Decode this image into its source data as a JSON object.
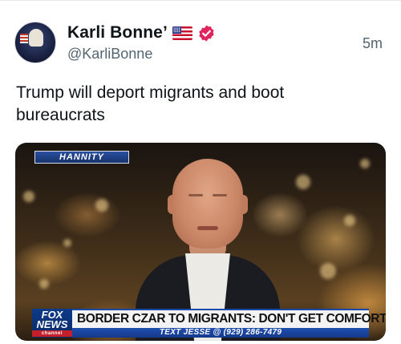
{
  "post": {
    "author": {
      "display_name": "Karli Bonne’",
      "handle": "@KarliBonne",
      "badges": [
        "us-flag-icon",
        "verified-badge-icon"
      ],
      "verified_color": "#e0245e"
    },
    "timestamp": "5m",
    "text": "Trump will deport migrants and boot bureaucrats",
    "media": {
      "show_logo": "HANNITY",
      "network": {
        "logo_line1": "FOX",
        "logo_line2": "NEWS",
        "logo_line3": "channel"
      },
      "headline": "BORDER CZAR TO MIGRANTS: DON'T GET COMFORTABLE",
      "ticker": "TEXT JESSE @ (929) 286-7479"
    }
  },
  "colors": {
    "text_primary": "#0f1419",
    "text_secondary": "#536471",
    "fox_blue": "#1a4aa8"
  }
}
